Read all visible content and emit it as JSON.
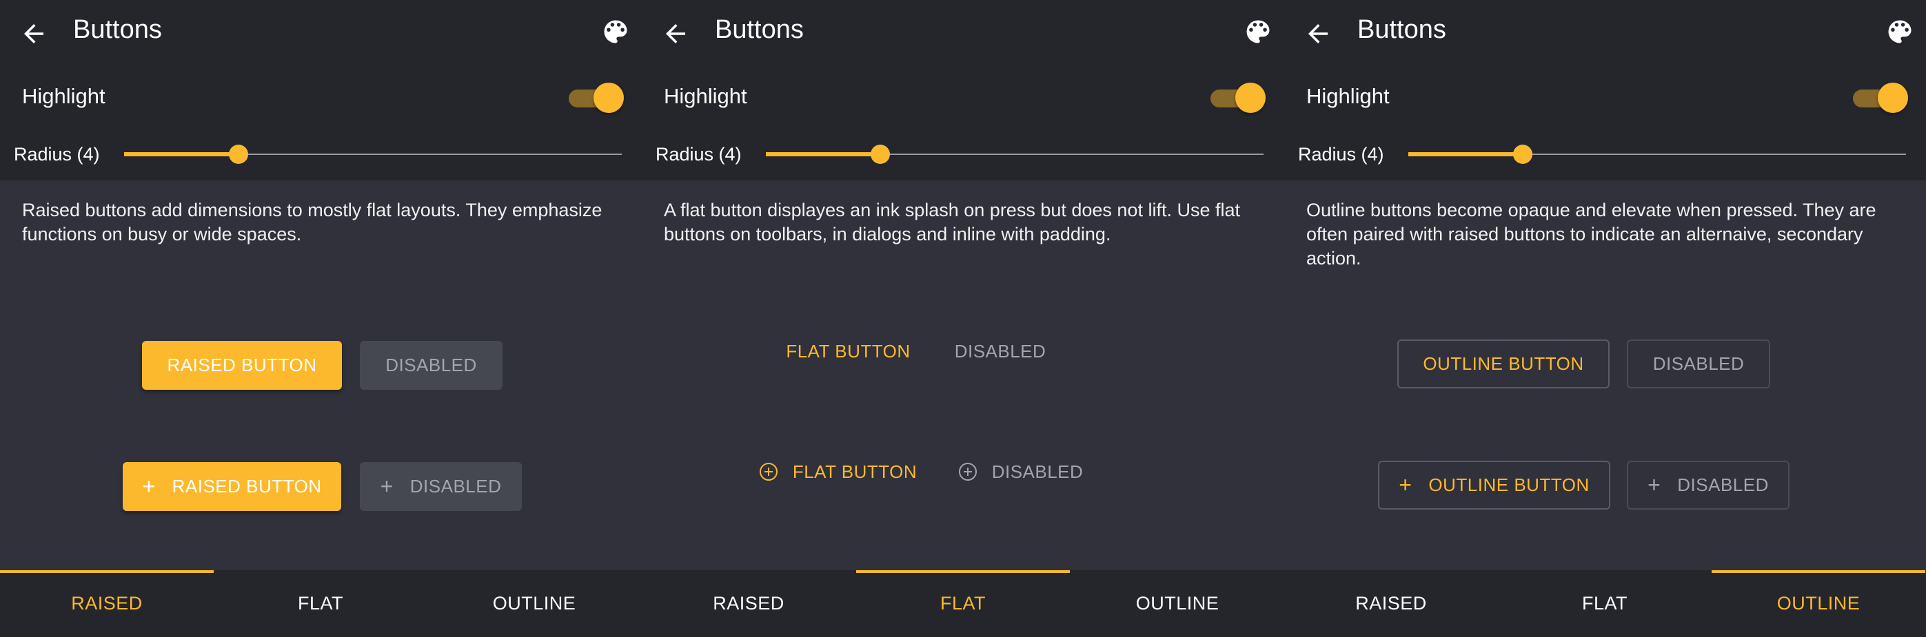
{
  "colors": {
    "accent": "#fdb92d",
    "appbar": "#25262c",
    "background": "#30313a",
    "disabled_bg": "#464851"
  },
  "screens": [
    {
      "title": "Buttons",
      "highlight_label": "Highlight",
      "highlight_on": true,
      "radius_label": "Radius (4)",
      "radius_fraction": 0.23,
      "description": "Raised buttons add dimensions to mostly flat layouts. They emphasize functions on busy or wide spaces.",
      "buttons": {
        "primary": "RAISED BUTTON",
        "disabled": "DISABLED",
        "icon_primary": "RAISED BUTTON",
        "icon_disabled": "DISABLED"
      },
      "tabs": [
        "RAISED",
        "FLAT",
        "OUTLINE"
      ],
      "active_tab": "RAISED"
    },
    {
      "title": "Buttons",
      "highlight_label": "Highlight",
      "highlight_on": true,
      "radius_label": "Radius (4)",
      "radius_fraction": 0.23,
      "description": "A flat button displayes an ink splash on press but does not lift. Use flat buttons on toolbars, in dialogs and inline with padding.",
      "buttons": {
        "primary": "FLAT BUTTON",
        "disabled": "DISABLED",
        "icon_primary": "FLAT BUTTON",
        "icon_disabled": "DISABLED"
      },
      "tabs": [
        "RAISED",
        "FLAT",
        "OUTLINE"
      ],
      "active_tab": "FLAT"
    },
    {
      "title": "Buttons",
      "highlight_label": "Highlight",
      "highlight_on": true,
      "radius_label": "Radius (4)",
      "radius_fraction": 0.23,
      "description": "Outline buttons become opaque and elevate when pressed. They are often paired with raised buttons to indicate an alternaive, secondary action.",
      "buttons": {
        "primary": "OUTLINE BUTTON",
        "disabled": "DISABLED",
        "icon_primary": "OUTLINE BUTTON",
        "icon_disabled": "DISABLED"
      },
      "tabs": [
        "RAISED",
        "FLAT",
        "OUTLINE"
      ],
      "active_tab": "OUTLINE"
    }
  ]
}
